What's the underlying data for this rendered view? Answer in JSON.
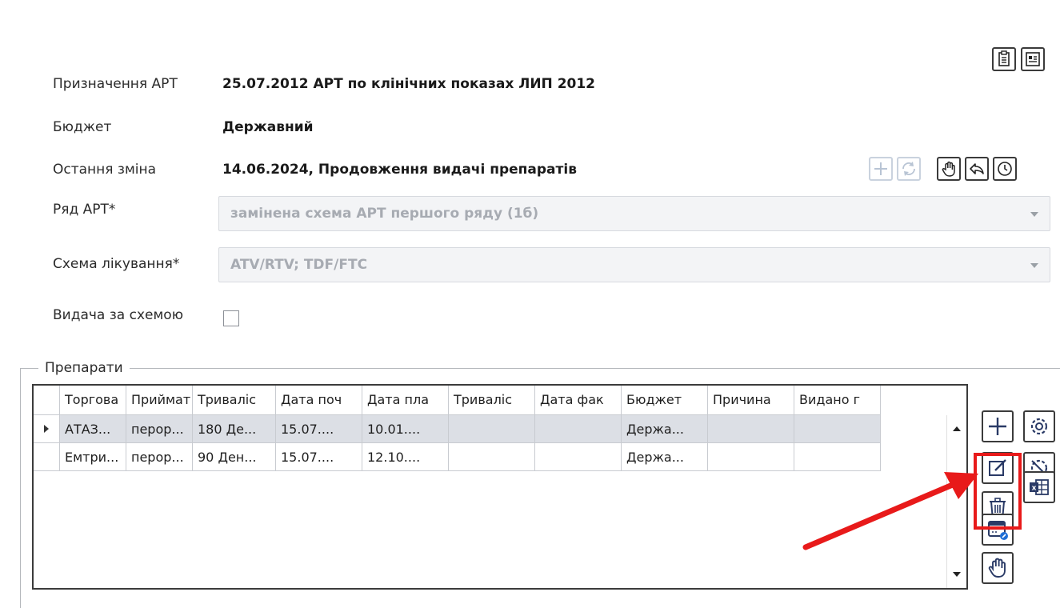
{
  "top_icons": [
    {
      "icon": "clipboard-list-icon"
    },
    {
      "icon": "report-icon"
    }
  ],
  "fields": {
    "purpose": {
      "label": "Призначення АРТ",
      "value": "25.07.2012 АРТ по клінічних показах ЛИП 2012"
    },
    "budget": {
      "label": "Бюджет",
      "value": "Державний"
    },
    "last_change": {
      "label": "Остання зміна",
      "value": "14.06.2024, Продовження видачі препаратів"
    },
    "art_line": {
      "label": "Ряд АРТ*",
      "value": "замінена схема АРТ першого ряду (1б)"
    },
    "regimen": {
      "label": "Схема лікування*",
      "value": "ATV/RTV; TDF/FTC"
    },
    "by_scheme": {
      "label": "Видача за схемою",
      "checked": false
    }
  },
  "change_toolbar": [
    {
      "icon": "plus-icon",
      "enabled": false
    },
    {
      "icon": "refresh-icon",
      "enabled": false
    },
    {
      "icon": "hand-icon",
      "enabled": true
    },
    {
      "icon": "reply-icon",
      "enabled": true
    },
    {
      "icon": "clock-icon",
      "enabled": true
    }
  ],
  "drugs": {
    "title": "Препарати",
    "columns": [
      "Торгова",
      "Приймат",
      "Триваліс",
      "Дата поч",
      "Дата пла",
      "Триваліс",
      "Дата фак",
      "Бюджет",
      "Причина",
      "Видано г"
    ],
    "rows": [
      [
        "АТАЗ...",
        "перор...",
        "180 Де...",
        "15.07....",
        "10.01....",
        "",
        "",
        "Держа...",
        "",
        ""
      ],
      [
        "Емтри...",
        "перор...",
        "90 Ден...",
        "15.07....",
        "12.10....",
        "",
        "",
        "Держа...",
        "",
        ""
      ]
    ],
    "selected_row": 0
  },
  "side_buttons": [
    {
      "icon": "plus-icon"
    },
    {
      "icon": "edit-icon"
    },
    {
      "icon": "trash-icon"
    },
    {
      "icon": "calendar-edit-icon"
    },
    {
      "icon": "hand-icon"
    }
  ],
  "side_buttons_right": [
    {
      "icon": "settings-icon"
    },
    {
      "icon": "settings-disabled-icon"
    },
    {
      "icon": "excel-icon"
    }
  ],
  "annotation": {
    "color": "#e81a1a"
  }
}
